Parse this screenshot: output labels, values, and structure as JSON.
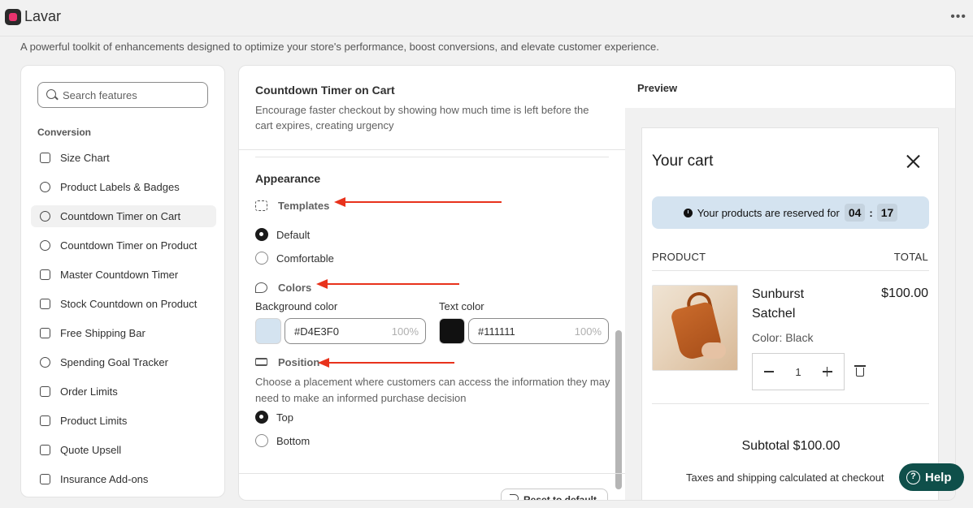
{
  "app": {
    "title": "Lavar",
    "subtitle": "A powerful toolkit of enhancements designed to optimize your store's performance, boost conversions, and elevate customer experience."
  },
  "sidebar": {
    "search_placeholder": "Search features",
    "section_label": "Conversion",
    "items": [
      {
        "label": "Size Chart",
        "icon": "size-chart-icon"
      },
      {
        "label": "Product Labels & Badges",
        "icon": "badge-icon"
      },
      {
        "label": "Countdown Timer on Cart",
        "icon": "clock-icon",
        "active": true
      },
      {
        "label": "Countdown Timer on Product",
        "icon": "clock-icon"
      },
      {
        "label": "Master Countdown Timer",
        "icon": "timer-icon"
      },
      {
        "label": "Stock Countdown on Product",
        "icon": "database-icon"
      },
      {
        "label": "Free Shipping Bar",
        "icon": "truck-icon"
      },
      {
        "label": "Spending Goal Tracker",
        "icon": "check-circle-icon"
      },
      {
        "label": "Order Limits",
        "icon": "inbox-icon"
      },
      {
        "label": "Product Limits",
        "icon": "tag-icon"
      },
      {
        "label": "Quote Upsell",
        "icon": "list-icon"
      },
      {
        "label": "Insurance Add-ons",
        "icon": "shield-icon"
      }
    ]
  },
  "settings": {
    "title": "Countdown Timer on Cart",
    "description": "Encourage faster checkout by showing how much time is left before the cart expires, creating urgency",
    "appearance_title": "Appearance",
    "templates": {
      "label": "Templates",
      "options": [
        {
          "label": "Default",
          "checked": true
        },
        {
          "label": "Comfortable",
          "checked": false
        }
      ]
    },
    "colors": {
      "label": "Colors",
      "background": {
        "label": "Background color",
        "hex": "#D4E3F0",
        "opacity": "100%"
      },
      "text": {
        "label": "Text color",
        "hex": "#111111",
        "opacity": "100%"
      }
    },
    "position": {
      "label": "Position",
      "description": "Choose a placement where customers can access the information they may need to make an informed purchase decision",
      "options": [
        {
          "label": "Top",
          "checked": true
        },
        {
          "label": "Bottom",
          "checked": false
        }
      ]
    },
    "reset_label": "Reset to default"
  },
  "preview": {
    "title": "Preview",
    "cart_title": "Your cart",
    "timer_text": "Your products are reserved for",
    "timer_minutes": "04",
    "timer_sep": ":",
    "timer_seconds": "17",
    "col_product": "PRODUCT",
    "col_total": "TOTAL",
    "product": {
      "name": "Sunburst Satchel",
      "price": "$100.00",
      "variant": "Color: Black",
      "quantity": "1"
    },
    "subtotal": "Subtotal $100.00",
    "taxes_note": "Taxes and shipping calculated at checkout"
  },
  "help_label": "Help",
  "colors": {
    "timer_bg": "#D4E3F0",
    "timer_text": "#111111",
    "annotation_arrow": "#e8321c",
    "help_button": "#0f4f4a"
  }
}
